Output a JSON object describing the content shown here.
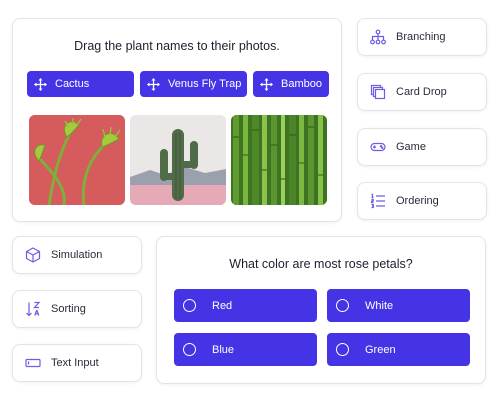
{
  "drag_drop": {
    "prompt": "Drag the plant names to their photos.",
    "chips": [
      "Cactus",
      "Venus Fly Trap",
      "Bamboo"
    ],
    "photos": [
      "venus-fly-trap-photo",
      "cactus-photo",
      "bamboo-photo"
    ]
  },
  "activity_types": {
    "branching": "Branching",
    "card_drop": "Card Drop",
    "game": "Game",
    "ordering": "Ordering",
    "simulation": "Simulation",
    "sorting": "Sorting",
    "text_input": "Text Input"
  },
  "quiz": {
    "question": "What color are most rose petals?",
    "options": [
      "Red",
      "White",
      "Blue",
      "Green"
    ]
  },
  "colors": {
    "accent": "#4534e6",
    "icon": "#6c5ce7",
    "card_border": "#e3e3ea"
  }
}
